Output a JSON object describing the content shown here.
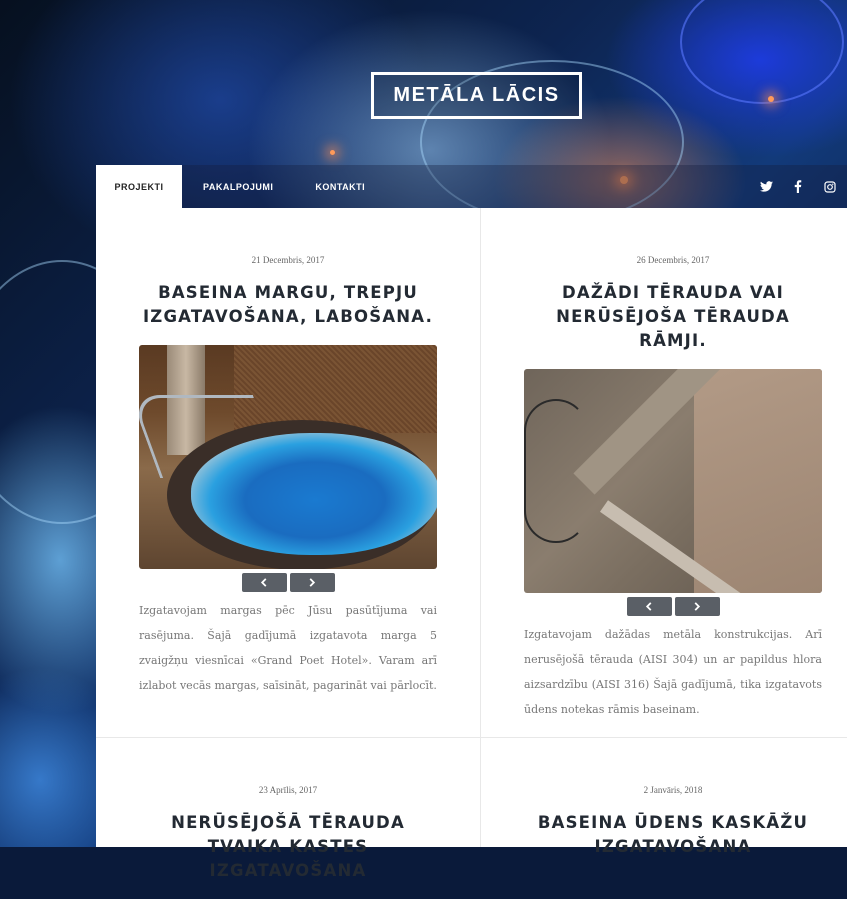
{
  "site": {
    "logo_text": "METĀLA LĀCIS"
  },
  "nav": {
    "tabs": [
      {
        "label": "PROJEKTI",
        "active": true
      },
      {
        "label": "PAKALPOJUMI",
        "active": false
      },
      {
        "label": "KONTAKTI",
        "active": false
      }
    ],
    "social": [
      "twitter-icon",
      "facebook-icon",
      "instagram-icon"
    ]
  },
  "posts": [
    {
      "date": "21 Decembris, 2017",
      "title": "BASEINA MARGU, TREPJU IZGATAVOŠANA, LABOŠANA.",
      "description": "Izgatavojam margas pēc Jūsu pasūtījuma vai rasējuma. Šajā gadījumā izgatavota marga 5 zvaigžņu viesnīcai «Grand Poet Hotel». Varam arī izlabot vecās margas, saīsināt, pagarināt vai pārlocīt."
    },
    {
      "date": "26 Decembris, 2017",
      "title": "DAŽĀDI TĒRAUDA VAI NERŪSĒJOŠA TĒRAUDA RĀMJI.",
      "description": "Izgatavojam dažādas metāla konstrukcijas. Arī nerusējošā tērauda (AISI 304) un ar papildus hlora aizsardzību (AISI 316) Šajā gadījumā, tika izgatavots ūdens notekas rāmis baseinam."
    },
    {
      "date": "23 Aprīlis, 2017",
      "title": "NERŪSĒJOŠĀ TĒRAUDA TVAIKA KASTES IZGATAVOŠANA"
    },
    {
      "date": "2 Janvāris, 2018",
      "title": "BASEINA ŪDENS KASKĀŽU IZGATAVOŠANA"
    }
  ],
  "colors": {
    "text_dark": "#232a33",
    "arrow_button": "#5a5f66",
    "nav_active_bg": "#ffffff"
  }
}
